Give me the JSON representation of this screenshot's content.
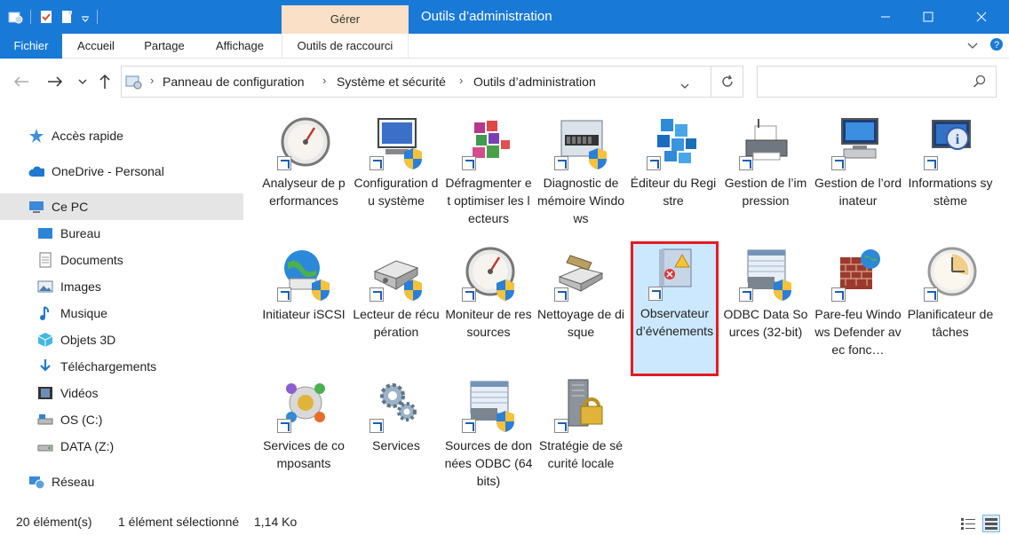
{
  "window": {
    "title": "Outils d’administration",
    "context_tab": "Gérer"
  },
  "ribbon": {
    "tabs": [
      "Fichier",
      "Accueil",
      "Partage",
      "Affichage",
      "Outils de raccourci"
    ]
  },
  "address": {
    "crumbs": [
      "Panneau de configuration",
      "Système et sécurité",
      "Outils d’administration"
    ],
    "search_placeholder": ""
  },
  "sidebar": {
    "items": [
      {
        "label": "Accès rapide",
        "icon": "star-icon"
      },
      {
        "label": "OneDrive - Personal",
        "icon": "cloud-icon"
      },
      {
        "label": "Ce PC",
        "icon": "computer-icon"
      },
      {
        "label": "Bureau",
        "icon": "desktop-icon"
      },
      {
        "label": "Documents",
        "icon": "document-icon"
      },
      {
        "label": "Images",
        "icon": "image-icon"
      },
      {
        "label": "Musique",
        "icon": "music-icon"
      },
      {
        "label": "Objets 3D",
        "icon": "cube-icon"
      },
      {
        "label": "Téléchargements",
        "icon": "download-icon"
      },
      {
        "label": "Vidéos",
        "icon": "video-icon"
      },
      {
        "label": "OS (C:)",
        "icon": "drive-icon"
      },
      {
        "label": "DATA (Z:)",
        "icon": "drive-icon"
      },
      {
        "label": "Réseau",
        "icon": "network-icon"
      }
    ]
  },
  "items": [
    {
      "label": "Analyseur de performances",
      "icon": "gauge-icon"
    },
    {
      "label": "Configuration du système",
      "icon": "system-config-icon"
    },
    {
      "label": "Défragmenter et optimiser les lecteurs",
      "icon": "defrag-icon"
    },
    {
      "label": "Diagnostic de mémoire Windows",
      "icon": "memory-icon"
    },
    {
      "label": "Éditeur du Registre",
      "icon": "registry-icon"
    },
    {
      "label": "Gestion de l’impression",
      "icon": "printer-icon"
    },
    {
      "label": "Gestion de l’ordinateur",
      "icon": "computer-management-icon"
    },
    {
      "label": "Informations système",
      "icon": "info-icon"
    },
    {
      "label": "Initiateur iSCSI",
      "icon": "globe-icon"
    },
    {
      "label": "Lecteur de récupération",
      "icon": "recovery-drive-icon"
    },
    {
      "label": "Moniteur de ressources",
      "icon": "gauge-icon"
    },
    {
      "label": "Nettoyage de disque",
      "icon": "disk-cleanup-icon"
    },
    {
      "label": "Observateur d’événements",
      "icon": "event-viewer-icon"
    },
    {
      "label": "ODBC Data Sources (32-bit)",
      "icon": "odbc-icon"
    },
    {
      "label": "Pare-feu Windows Defender avec fonc…",
      "icon": "firewall-icon"
    },
    {
      "label": "Planificateur de tâches",
      "icon": "clock-icon"
    },
    {
      "label": "Services de composants",
      "icon": "components-icon"
    },
    {
      "label": "Services",
      "icon": "gears-icon"
    },
    {
      "label": "Sources de données ODBC (64 bits)",
      "icon": "odbc-icon"
    },
    {
      "label": "Stratégie de sécurité locale",
      "icon": "security-policy-icon"
    }
  ],
  "selected_item": "Observateur d’événements",
  "status": {
    "count": "20 élément(s)",
    "selection": "1 élément sélectionné",
    "size": "1,14 Ko"
  },
  "colors": {
    "accent": "#1979d6",
    "context_tab": "#f9e0c6",
    "selection": "#cce8ff",
    "highlight_border": "#e31c23"
  }
}
